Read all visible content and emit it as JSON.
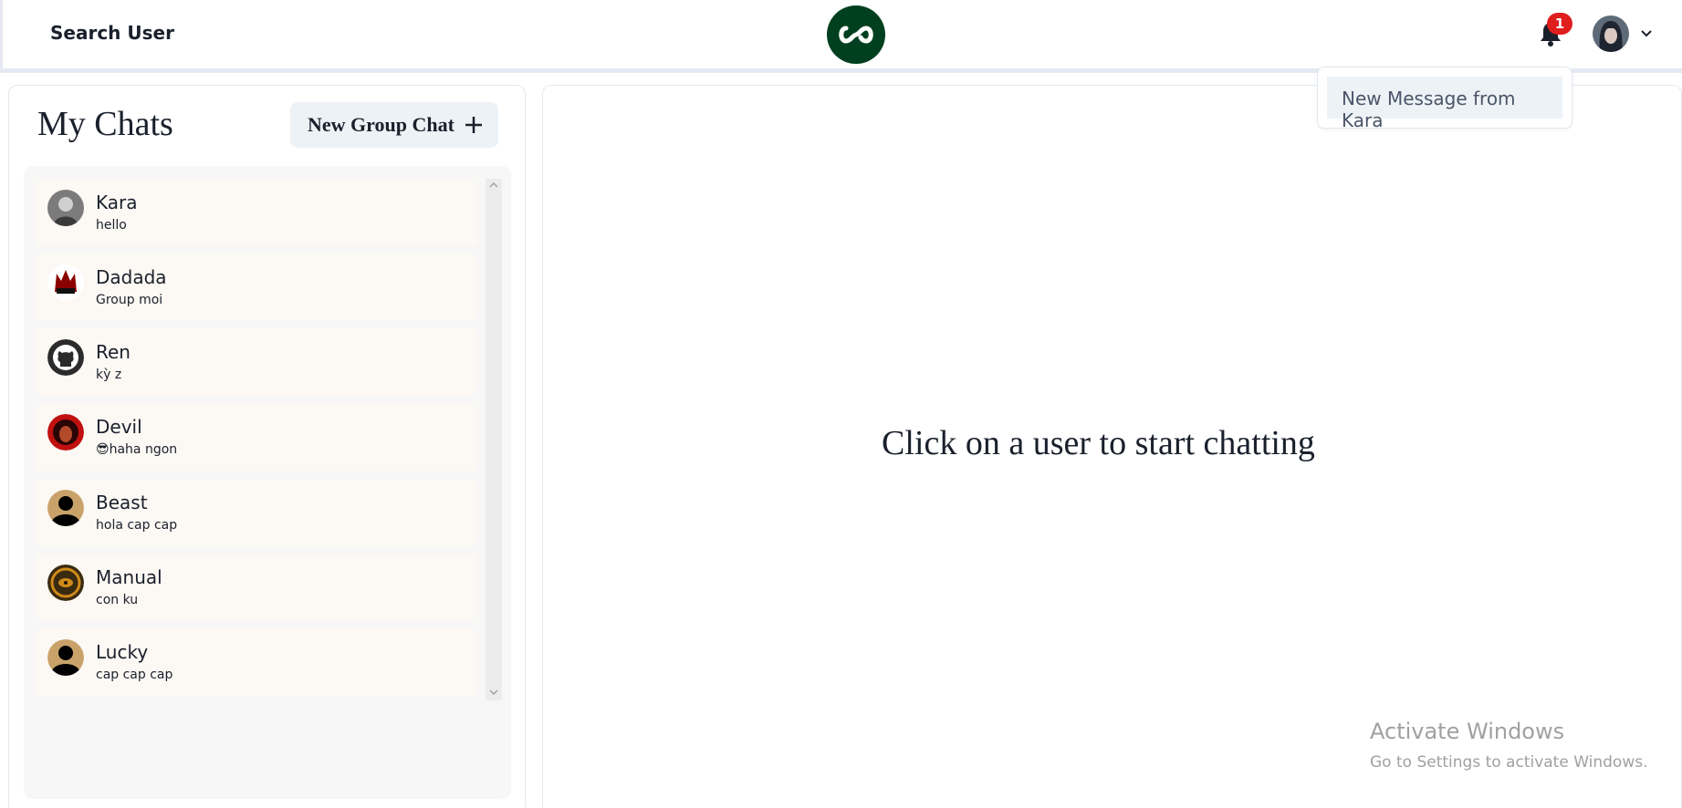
{
  "header": {
    "search_label": "Search User",
    "logo_icon": "infinity-icon",
    "notification_count": "1",
    "bell_icon": "bell-icon",
    "accent_color": "#00401f"
  },
  "notifications": {
    "items": [
      "New Message from Kara"
    ]
  },
  "sidebar": {
    "title": "My Chats",
    "new_group_label": "New Group Chat",
    "chats": [
      {
        "name": "Kara",
        "last_message": "hello"
      },
      {
        "name": "Dadada",
        "last_message": "Group moi"
      },
      {
        "name": "Ren",
        "last_message": "kỳ z"
      },
      {
        "name": "Devil",
        "last_message": "😎haha ngon"
      },
      {
        "name": "Beast",
        "last_message": "hola cap cap"
      },
      {
        "name": "Manual",
        "last_message": "con ku"
      },
      {
        "name": "Lucky",
        "last_message": "cap cap cap"
      }
    ]
  },
  "main": {
    "placeholder": "Click on a user to start chatting"
  },
  "watermark": {
    "title": "Activate Windows",
    "subtitle": "Go to Settings to activate Windows."
  }
}
